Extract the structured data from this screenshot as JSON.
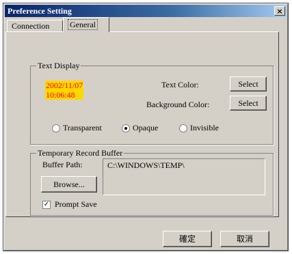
{
  "window": {
    "title": "Preference Setting",
    "close_glyph": "×"
  },
  "tabs": [
    {
      "label": "Connection"
    },
    {
      "label": "General"
    }
  ],
  "text_display": {
    "group_label": "Text Display",
    "timestamp_date": "2002/11/07",
    "timestamp_time": "10:06:48",
    "text_color_label": "Text Color:",
    "background_color_label": "Background Color:",
    "select_label": "Select",
    "radios": [
      {
        "label": "Transparent",
        "checked": false
      },
      {
        "label": "Opaque",
        "checked": true
      },
      {
        "label": "Invisible",
        "checked": false
      }
    ],
    "highlight_bg": "#ffd700",
    "highlight_fg": "#ff0000"
  },
  "temp_buffer": {
    "group_label": "Temporary Record Buffer",
    "buffer_path_label": "Buffer Path:",
    "buffer_path_value": "C:\\WINDOWS\\TEMP\\",
    "browse_label": "Browse...",
    "prompt_save_label": "Prompt Save",
    "prompt_save_checked": true,
    "check_glyph": "✓"
  },
  "footer": {
    "ok_label": "確定",
    "cancel_label": "取消"
  }
}
